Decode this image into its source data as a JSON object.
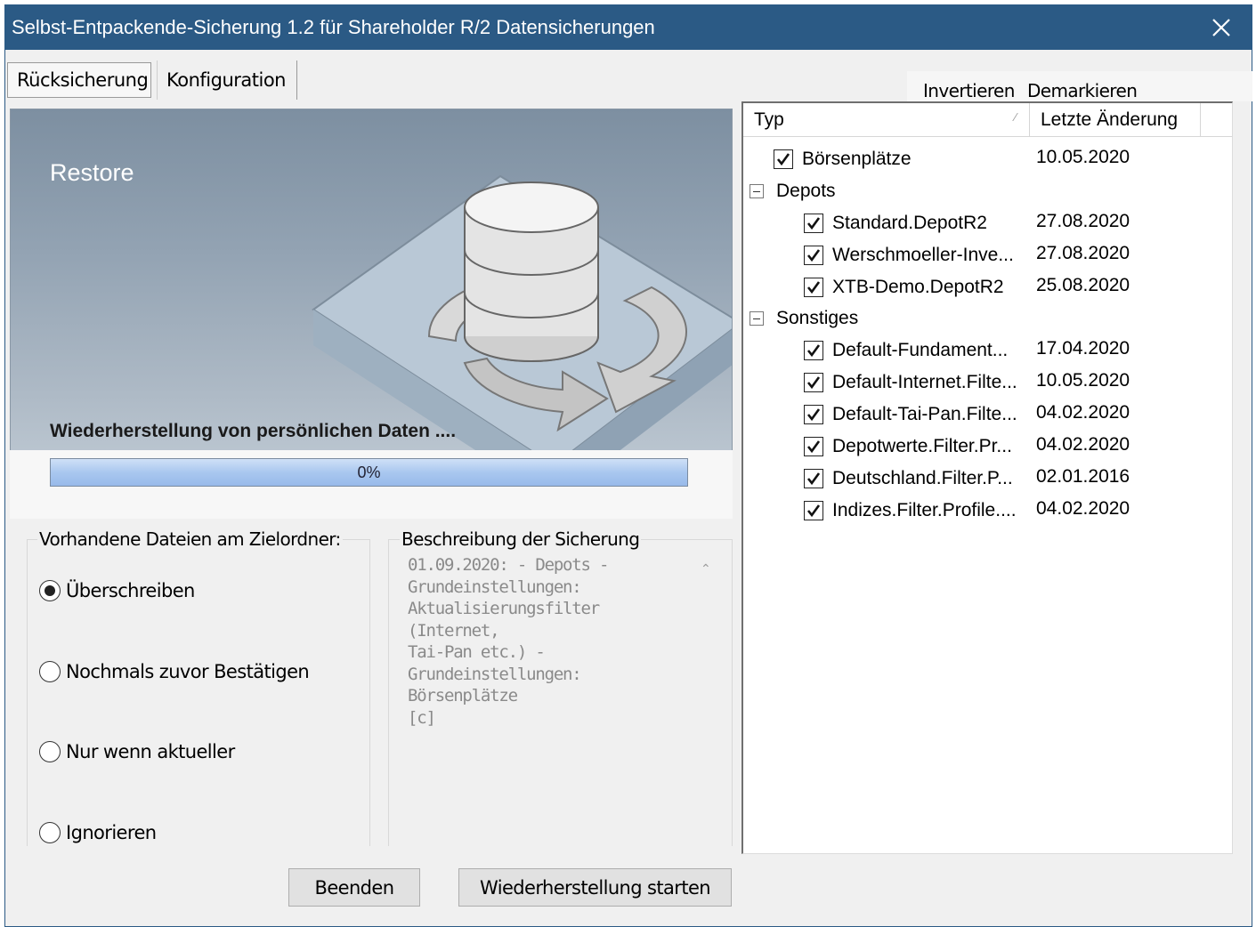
{
  "window": {
    "title": "Selbst-Entpackende-Sicherung 1.2 für Shareholder R/2 Datensicherungen",
    "close_icon": "close-icon"
  },
  "tabs": [
    {
      "label": "Rücksicherung",
      "active": true
    },
    {
      "label": "Konfiguration",
      "active": false
    }
  ],
  "banner": {
    "heading": "Restore",
    "subtitle": "Wiederherstellung von persönlichen Daten ....",
    "progress_label": "0%",
    "progress_value": 0
  },
  "existing_files": {
    "title": "Vorhandene Dateien am Zielordner:",
    "options": [
      {
        "label": "Überschreiben",
        "selected": true
      },
      {
        "label": "Nochmals zuvor Bestätigen",
        "selected": false
      },
      {
        "label": "Nur wenn aktueller",
        "selected": false
      },
      {
        "label": "Ignorieren",
        "selected": false
      }
    ]
  },
  "description": {
    "title": "Beschreibung der Sicherung",
    "lines": [
      "01.09.2020: - Depots -",
      "Grundeinstellungen:",
      "Aktualisierungsfilter (Internet,",
      "Tai-Pan etc.) -",
      "Grundeinstellungen: Börsenplätze",
      "[c]"
    ]
  },
  "buttons": {
    "quit": "Beenden",
    "start": "Wiederherstellung starten"
  },
  "tree_toolbar": {
    "invert": "Invertieren",
    "unmark": "Demarkieren"
  },
  "tree": {
    "columns": [
      "Typ",
      "Letzte Änderung"
    ],
    "rows": [
      {
        "label": "Börsenplätze",
        "date": "10.05.2020",
        "checked": true,
        "group": false
      },
      {
        "label": "Depots",
        "date": "",
        "checked": false,
        "group": true
      },
      {
        "label": "Standard.DepotR2",
        "date": "27.08.2020",
        "checked": true,
        "group": false
      },
      {
        "label": "Werschmoeller-Inve...",
        "date": "27.08.2020",
        "checked": true,
        "group": false
      },
      {
        "label": "XTB-Demo.DepotR2",
        "date": "25.08.2020",
        "checked": true,
        "group": false
      },
      {
        "label": "Sonstiges",
        "date": "",
        "checked": false,
        "group": true
      },
      {
        "label": "Default-Fundament...",
        "date": "17.04.2020",
        "checked": true,
        "group": false
      },
      {
        "label": "Default-Internet.Filte...",
        "date": "10.05.2020",
        "checked": true,
        "group": false
      },
      {
        "label": "Default-Tai-Pan.Filte...",
        "date": "04.02.2020",
        "checked": true,
        "group": false
      },
      {
        "label": "Depotwerte.Filter.Pr...",
        "date": "04.02.2020",
        "checked": true,
        "group": false
      },
      {
        "label": "Deutschland.Filter.P...",
        "date": "02.01.2016",
        "checked": true,
        "group": false
      },
      {
        "label": "Indizes.Filter.Profile....",
        "date": "04.02.2020",
        "checked": true,
        "group": false
      }
    ]
  }
}
